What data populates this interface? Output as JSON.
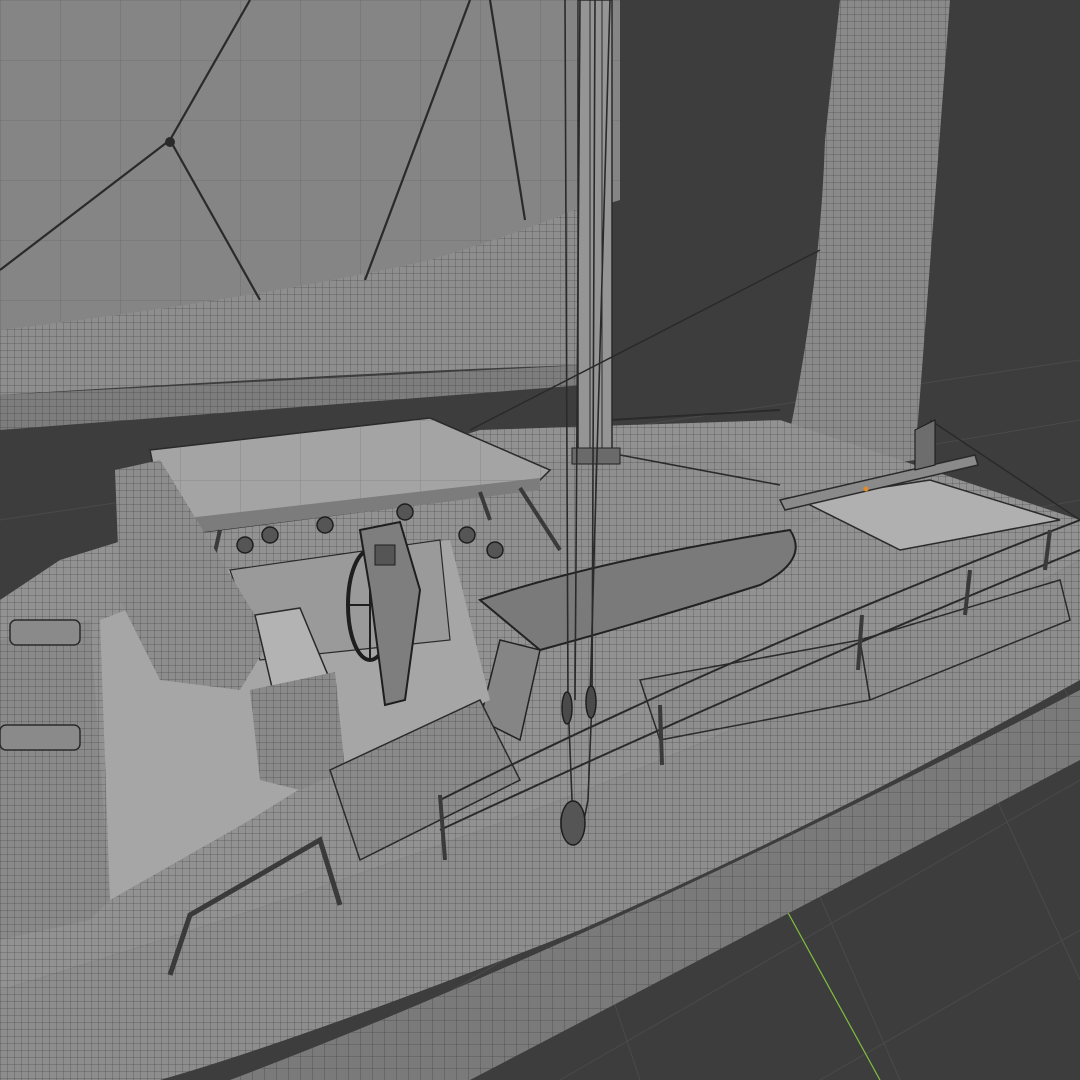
{
  "viewport": {
    "background": "#3d3d3d",
    "grid_color": "#4a4a4a",
    "axis_y_color": "#7fbf3f"
  },
  "model": {
    "surface_color": "#8c8c8c",
    "surface_light": "#9a9a9a",
    "surface_dark": "#7a7a7a",
    "wire_color": "#2a2a2a",
    "sail_color": "#878787",
    "accent_orange": "#e08a2a"
  }
}
